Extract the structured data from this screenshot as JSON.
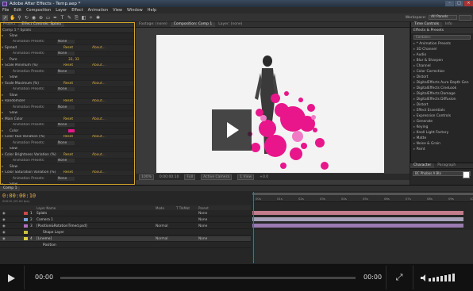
{
  "window": {
    "title": "Adobe After Effects - Temp.aep *",
    "buttons": [
      "–",
      "□",
      "×"
    ]
  },
  "menu": [
    "File",
    "Edit",
    "Composition",
    "Layer",
    "Effect",
    "Animation",
    "View",
    "Window",
    "Help"
  ],
  "toolbar": {
    "tools": [
      "selection-tool",
      "hand-tool",
      "zoom-tool",
      "rotate-tool",
      "camera-tool",
      "pan-behind-tool",
      "rectangle-tool",
      "pen-tool",
      "text-tool",
      "brush-tool",
      "clone-tool",
      "eraser-tool",
      "roto-tool",
      "puppet-tool"
    ],
    "workspace_label": "Workspace:",
    "workspace_value": "All Panels"
  },
  "left_panel": {
    "tabs": [
      "Project",
      "Effect Controls: Splats"
    ],
    "header": "Comp 1 * Splats",
    "rows": [
      {
        "name": "Slow",
        "kind": "sub"
      },
      {
        "name": "Animation Presets:",
        "kind": "preset",
        "value": "None"
      },
      {
        "name": "Spread",
        "kind": "reset"
      },
      {
        "name": "Animation Presets:",
        "kind": "preset",
        "value": "None"
      },
      {
        "name": "Pure",
        "kind": "value",
        "value": "33, 33"
      },
      {
        "name": "Scale Minimum (%)",
        "kind": "reset"
      },
      {
        "name": "Animation Presets:",
        "kind": "preset",
        "value": "None"
      },
      {
        "name": "Slow",
        "kind": "sub"
      },
      {
        "name": "Scale Maximum (%)",
        "kind": "reset"
      },
      {
        "name": "Animation Presets:",
        "kind": "preset",
        "value": "None"
      },
      {
        "name": "Slow",
        "kind": "sub"
      },
      {
        "name": "Randomizer",
        "kind": "reset"
      },
      {
        "name": "Animation Presets:",
        "kind": "preset",
        "value": "None"
      },
      {
        "name": "Slow",
        "kind": "sub"
      },
      {
        "name": "Main Color",
        "kind": "reset"
      },
      {
        "name": "Animation Presets:",
        "kind": "preset",
        "value": "None"
      },
      {
        "name": "Color",
        "kind": "color"
      },
      {
        "name": "Color Hue Variation (%)",
        "kind": "reset"
      },
      {
        "name": "Animation Presets:",
        "kind": "preset",
        "value": "None"
      },
      {
        "name": "Slow",
        "kind": "sub"
      },
      {
        "name": "Color Brightness Variation (%)",
        "kind": "reset"
      },
      {
        "name": "Animation Presets:",
        "kind": "preset",
        "value": "None"
      },
      {
        "name": "Slow",
        "kind": "sub"
      },
      {
        "name": "Color Saturation Variation (%)",
        "kind": "reset"
      },
      {
        "name": "Animation Presets:",
        "kind": "preset",
        "value": "None"
      },
      {
        "name": "Slow",
        "kind": "sub"
      },
      {
        "name": "Color Randomizer",
        "kind": "reset"
      },
      {
        "name": "Animation Presets:",
        "kind": "preset",
        "value": "None"
      }
    ],
    "reset_label": "Reset",
    "about_label": "About..."
  },
  "comp_panel": {
    "tabs": [
      "Footage: (none)",
      "Composition: Comp 1",
      "Layer: (none)"
    ],
    "viewer_bar": [
      "100%",
      "0:00:00:10",
      "Full",
      "Active Camera",
      "1 View",
      "+0.0"
    ]
  },
  "right_panel": {
    "tabs": [
      "Time Controls",
      "Info"
    ],
    "title": "Effects & Presets",
    "search_placeholder": "Contains:",
    "items": [
      "* Animation Presets",
      "3D Channel",
      "Audio",
      "Blur & Sharpen",
      "Channel",
      "Color Correction",
      "Distort",
      "DigitalEffects Aura Depth Gen",
      "DigitalEffects CineLook",
      "DigitalEffects Damage",
      "DigitalEffects Diffusion",
      "Distort",
      "Effect Essentials",
      "Expression Controls",
      "Generate",
      "Keying",
      "Knoll Light Factory",
      "Matte",
      "Noise & Grain",
      "Paint"
    ],
    "character_tabs": [
      "Character",
      "Paragraph"
    ],
    "character_font": "BC Phobos A Bla"
  },
  "timeline": {
    "tab": "Comp 1",
    "time": "0:00:00:10",
    "fps": "00010 (25.00 fps)",
    "columns": [
      "Layer Name",
      "Mode",
      "T TrkMat",
      "Parent"
    ],
    "layers": [
      {
        "num": "1",
        "name": "Splats",
        "mode": "",
        "parent": "None",
        "color": "#c84a4a",
        "bar_color": "#c27c8c"
      },
      {
        "num": "2",
        "name": "Camera 1",
        "mode": "",
        "parent": "None",
        "color": "#7aa0d8",
        "bar_color": "#a6a0b8"
      },
      {
        "num": "3",
        "name": "[Position&RotationTimed.psd]",
        "mode": "Normal",
        "parent": "None",
        "color": "#b070c0",
        "bar_color": "#9a7ab0"
      },
      {
        "num": "",
        "name": "Shape Layer",
        "mode": "",
        "parent": "",
        "color": "#c8c040",
        "bar_color": "#b8a040"
      },
      {
        "num": "4",
        "name": "[Lineme]",
        "mode": "Normal",
        "parent": "None",
        "color": "#d8d040",
        "bar_color": "#e0cc3a"
      },
      {
        "num": "",
        "name": "Position",
        "mode": "",
        "parent": "",
        "color": "",
        "bar_color": ""
      }
    ],
    "ruler_ticks": [
      "00s",
      "01s",
      "02s",
      "03s",
      "04s",
      "05s",
      "06s",
      "07s",
      "08s",
      "09s",
      "10s"
    ]
  },
  "player": {
    "current_time": "00:00",
    "duration": "00:00",
    "progress": 0,
    "volume": 1
  },
  "colors": {
    "accent_orange": "#e6b84a",
    "splat_pink": "#e8168a",
    "playhead_red": "#dd3333"
  }
}
